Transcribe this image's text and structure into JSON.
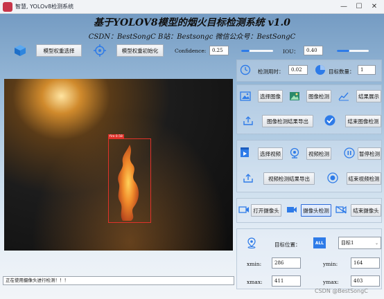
{
  "window": {
    "title": "智慧, YOLOv8检测系统",
    "minimize": "—",
    "maximize": "☐",
    "close": "✕"
  },
  "header": {
    "title": "基于YOLOV8模型的烟火目标检测系统 v1.0",
    "subtitle": "CSDN：BestSongC   B站：Bestsongc   微信公众号：BestSongC"
  },
  "toolbar": {
    "select_weights": "模型权重选择",
    "init_weights": "模型权重初始化",
    "confidence_label": "Confidence:",
    "confidence_value": "0.25",
    "confidence_level": 0.25,
    "iou_label": "IOU：",
    "iou_value": "0.40",
    "iou_level": 0.4
  },
  "stats": {
    "time_label": "检测用时：",
    "time_value": "0.02",
    "count_label": "目标数量：",
    "count_value": "1"
  },
  "image_section": {
    "select_image": "选择图像",
    "detect_image": "图像检测",
    "show_results": "结果展示",
    "export_results": "图像检测结果导出",
    "stop_detect": "结束图像检测"
  },
  "video_section": {
    "select_video": "选择视频",
    "detect_video": "视频检测",
    "pause_detect": "暂停检测",
    "export_results": "视频检测结果导出",
    "stop_detect": "结束视频检测"
  },
  "camera_section": {
    "open_camera": "打开摄像头",
    "detect_camera": "摄像头检测",
    "stop_camera": "结束摄像头"
  },
  "target": {
    "position_label": "目标位置：",
    "select_value": "目标1",
    "all_label": "ALL",
    "xmin_label": "xmin:",
    "xmin_value": "286",
    "ymin_label": "ymin:",
    "ymin_value": "164",
    "xmax_label": "xmax:",
    "xmax_value": "411",
    "ymax_label": "ymax:",
    "ymax_value": "403"
  },
  "detection": {
    "box_label": "fire 0.58"
  },
  "status_bar": {
    "message": "正在使用摄像头进行检测！！！"
  },
  "watermark": "CSDN @BestSongC"
}
